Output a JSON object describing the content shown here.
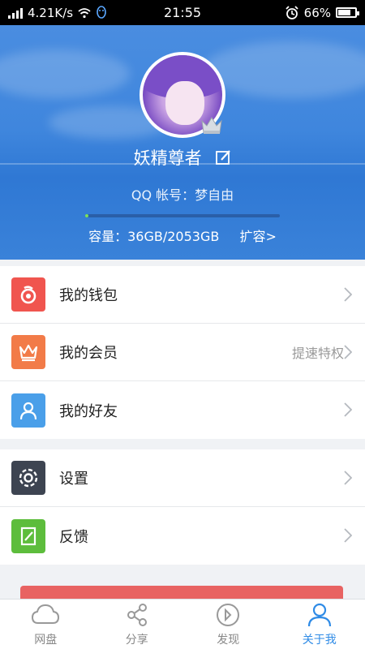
{
  "status_bar": {
    "speed": "4.21K/s",
    "time": "21:55",
    "battery": "66%",
    "battery_level": 0.66
  },
  "profile": {
    "nickname": "妖精尊者",
    "qq_label": "QQ 帐号：梦自由",
    "capacity_text": "容量：36GB/2053GB",
    "expand_link": "扩容>",
    "usage_fraction": 0.0175
  },
  "menu_group1": [
    {
      "label": "我的钱包",
      "icon": "wallet-icon",
      "color": "#f0554f",
      "extra": ""
    },
    {
      "label": "我的会员",
      "icon": "crown-icon",
      "color": "#f27b48",
      "extra": "提速特权"
    },
    {
      "label": "我的好友",
      "icon": "person-icon",
      "color": "#4a9fe9",
      "extra": ""
    }
  ],
  "menu_group2": [
    {
      "label": "设置",
      "icon": "gear-icon",
      "color": "#3d4451",
      "extra": ""
    },
    {
      "label": "反馈",
      "icon": "feedback-icon",
      "color": "#5dbd3c",
      "extra": ""
    }
  ],
  "tabs": [
    {
      "label": "网盘",
      "icon": "cloud-icon"
    },
    {
      "label": "分享",
      "icon": "share-icon"
    },
    {
      "label": "发现",
      "icon": "compass-icon"
    },
    {
      "label": "关于我",
      "icon": "user-icon",
      "active": true
    }
  ],
  "colors": {
    "accent": "#2f8be6",
    "header_blue": "#3f86dd",
    "logout_red": "#e86362"
  }
}
